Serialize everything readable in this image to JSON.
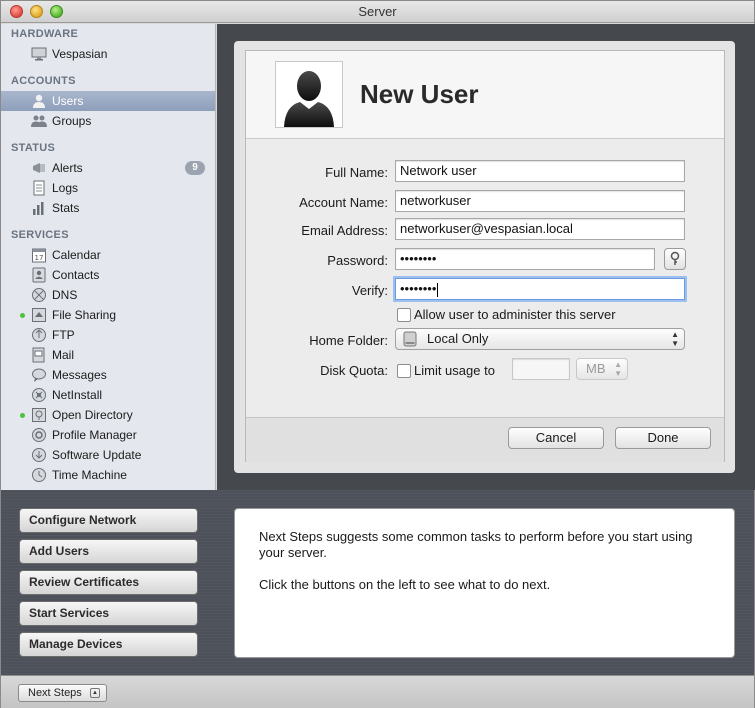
{
  "window": {
    "title": "Server"
  },
  "sidebar": {
    "hardware": {
      "heading": "HARDWARE",
      "items": [
        {
          "label": "Vespasian",
          "icon": "display-icon"
        }
      ]
    },
    "accounts": {
      "heading": "ACCOUNTS",
      "items": [
        {
          "label": "Users",
          "icon": "user-icon",
          "selected": true
        },
        {
          "label": "Groups",
          "icon": "group-icon"
        }
      ]
    },
    "status": {
      "heading": "STATUS",
      "items": [
        {
          "label": "Alerts",
          "icon": "megaphone-icon",
          "badge": "9"
        },
        {
          "label": "Logs",
          "icon": "document-icon"
        },
        {
          "label": "Stats",
          "icon": "bar-chart-icon"
        }
      ]
    },
    "services": {
      "heading": "SERVICES",
      "items": [
        {
          "label": "Calendar",
          "icon": "calendar-icon"
        },
        {
          "label": "Contacts",
          "icon": "contacts-icon"
        },
        {
          "label": "DNS",
          "icon": "dns-icon"
        },
        {
          "label": "File Sharing",
          "icon": "file-sharing-icon",
          "running": true
        },
        {
          "label": "FTP",
          "icon": "ftp-icon"
        },
        {
          "label": "Mail",
          "icon": "mail-icon"
        },
        {
          "label": "Messages",
          "icon": "messages-icon"
        },
        {
          "label": "NetInstall",
          "icon": "netinstall-icon"
        },
        {
          "label": "Open Directory",
          "icon": "open-directory-icon",
          "running": true
        },
        {
          "label": "Profile Manager",
          "icon": "profile-manager-icon"
        },
        {
          "label": "Software Update",
          "icon": "software-update-icon"
        },
        {
          "label": "Time Machine",
          "icon": "time-machine-icon"
        }
      ]
    }
  },
  "dialog": {
    "title": "New User",
    "fields": {
      "full_name": {
        "label": "Full Name:",
        "value": "Network user"
      },
      "account_name": {
        "label": "Account Name:",
        "value": "networkuser"
      },
      "email": {
        "label": "Email Address:",
        "value": "networkuser@vespasian.local"
      },
      "password": {
        "label": "Password:",
        "value": "••••••••"
      },
      "verify": {
        "label": "Verify:",
        "value": "••••••••"
      }
    },
    "admin_checkbox": {
      "label": "Allow user to administer this server",
      "checked": false
    },
    "home_folder": {
      "label": "Home Folder:",
      "value": "Local Only"
    },
    "disk_quota": {
      "label": "Disk Quota:",
      "checkbox_label": "Limit usage to",
      "checked": false,
      "value": "",
      "unit": "MB"
    },
    "cancel_label": "Cancel",
    "done_label": "Done"
  },
  "next_steps": {
    "buttons": [
      "Configure Network",
      "Add Users",
      "Review Certificates",
      "Start Services",
      "Manage Devices"
    ],
    "help_text_1": "Next Steps suggests some common tasks to perform before you start using your server.",
    "help_text_2": "Click the buttons on the left to see what to do next."
  },
  "statusbar": {
    "toggle_label": "Next Steps"
  },
  "colors": {
    "running_dot": "#4dc23a",
    "selection": "#8e9fba",
    "dark_panel": "#45484d"
  }
}
